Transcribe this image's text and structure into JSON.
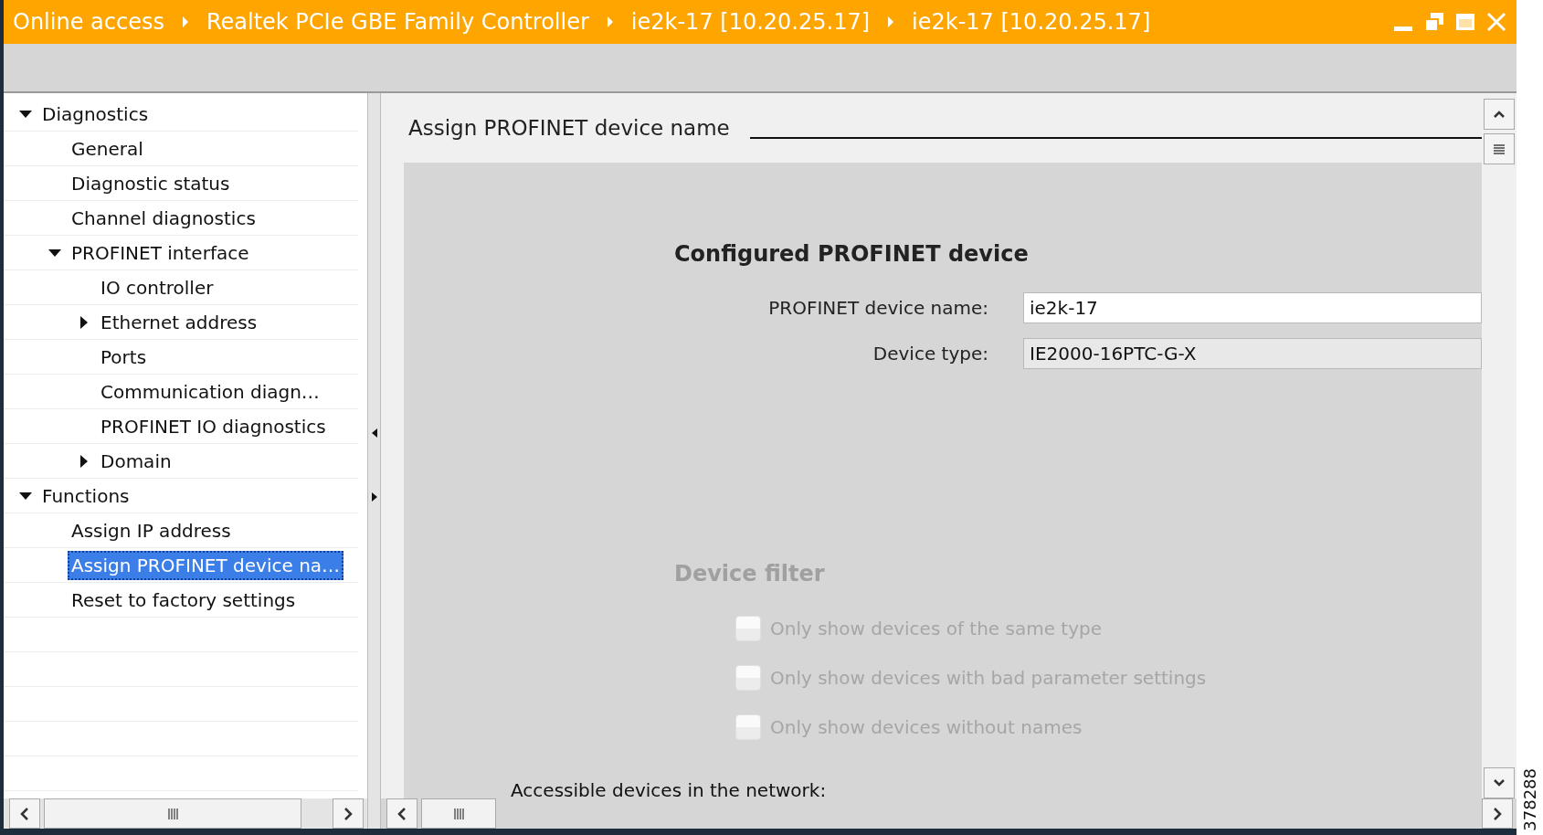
{
  "window": {
    "breadcrumb": [
      "Online access",
      "Realtek PCIe GBE Family Controller",
      "ie2k-17 [10.20.25.17]",
      "ie2k-17 [10.20.25.17]"
    ]
  },
  "tree": [
    {
      "label": "Diagnostics",
      "expanded": true,
      "selected": false,
      "children": [
        {
          "label": "General",
          "selected": false
        },
        {
          "label": "Diagnostic status",
          "selected": false
        },
        {
          "label": "Channel diagnostics",
          "selected": false
        },
        {
          "label": "PROFINET interface",
          "expanded": true,
          "selected": false,
          "children": [
            {
              "label": "IO controller",
              "selected": false
            },
            {
              "label": "Ethernet address",
              "expanded": false,
              "selected": false
            },
            {
              "label": "Ports",
              "selected": false
            },
            {
              "label": "Communication diagn…",
              "selected": false
            },
            {
              "label": "PROFINET IO diagnostics",
              "selected": false
            },
            {
              "label": "Domain",
              "expanded": false,
              "selected": false
            }
          ]
        }
      ]
    },
    {
      "label": "Functions",
      "expanded": true,
      "selected": false,
      "children": [
        {
          "label": "Assign IP address",
          "selected": false
        },
        {
          "label": "Assign PROFINET device na…",
          "selected": true
        },
        {
          "label": "Reset to factory settings",
          "selected": false
        }
      ]
    }
  ],
  "section_title": "Assign PROFINET device name",
  "configured": {
    "heading": "Configured PROFINET device",
    "fields": [
      {
        "label": "PROFINET device name:",
        "value": "ie2k-17",
        "readonly": false
      },
      {
        "label": "Device type:",
        "value": "IE2000-16PTC-G-X",
        "readonly": true
      }
    ]
  },
  "device_filter": {
    "heading": "Device filter",
    "disabled": true,
    "options": [
      {
        "label": "Only show devices of the same type",
        "checked": false,
        "disabled": true
      },
      {
        "label": "Only show devices with bad parameter settings",
        "checked": false,
        "disabled": true
      },
      {
        "label": "Only show devices without names",
        "checked": false,
        "disabled": true
      }
    ]
  },
  "accessible_label": "Accessible devices in the network:",
  "figure_id": "378288"
}
